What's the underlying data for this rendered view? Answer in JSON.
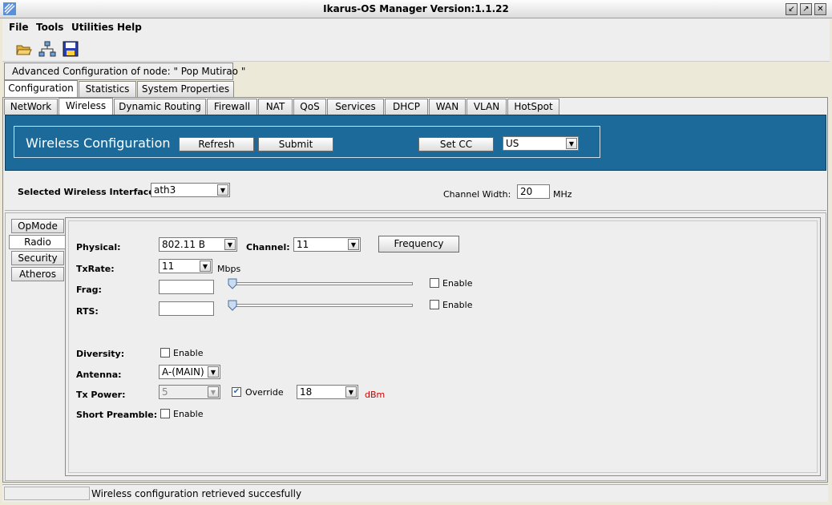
{
  "window": {
    "title": "Ikarus-OS Manager   Version:1.1.22"
  },
  "menu": {
    "items": [
      "File",
      "Tools",
      "Utilities",
      "Help"
    ]
  },
  "toolbar": {
    "icons": [
      "open-folder-icon",
      "network-icon",
      "save-icon"
    ]
  },
  "node": {
    "label": "Advanced Configuration of node:  \" Pop Mutirao \""
  },
  "main_tabs": [
    "Configuration",
    "Statistics",
    "System Properties"
  ],
  "sub_tabs": [
    "NetWork",
    "Wireless",
    "Dynamic Routing",
    "Firewall",
    "NAT",
    "QoS",
    "Services",
    "DHCP",
    "WAN",
    "VLAN",
    "HotSpot"
  ],
  "header": {
    "title": "Wireless Configuration",
    "refresh": "Refresh",
    "submit": "Submit",
    "setcc": "Set CC",
    "country": "US"
  },
  "iface": {
    "label": "Selected Wireless Interface:",
    "value": "ath3",
    "width_label": "Channel Width:",
    "width_value": "20",
    "width_unit": "MHz"
  },
  "side_tabs": [
    "OpMode",
    "Radio",
    "Security",
    "Atheros"
  ],
  "radio": {
    "physical_label": "Physical:",
    "physical_value": "802.11 B",
    "channel_label": "Channel:",
    "channel_value": "11",
    "frequency_button": "Frequency",
    "txrate_label": "TxRate:",
    "txrate_value": "11",
    "txrate_unit": "Mbps",
    "frag_label": "Frag:",
    "frag_value": "",
    "frag_enable": "Enable",
    "rts_label": "RTS:",
    "rts_value": "",
    "rts_enable": "Enable",
    "diversity_label": "Diversity:",
    "diversity_enable": "Enable",
    "antenna_label": "Antenna:",
    "antenna_value": "A-(MAIN)",
    "txpower_label": "Tx Power:",
    "txpower_value": "5",
    "override_label": "Override",
    "override_value": "18",
    "dbm": "dBm",
    "preamble_label": "Short Preamble:",
    "preamble_enable": "Enable"
  },
  "status": {
    "message": "Wireless configuration retrieved succesfully"
  },
  "colors": {
    "header_bg": "#1b6a9a",
    "dbm": "#cc0000"
  }
}
